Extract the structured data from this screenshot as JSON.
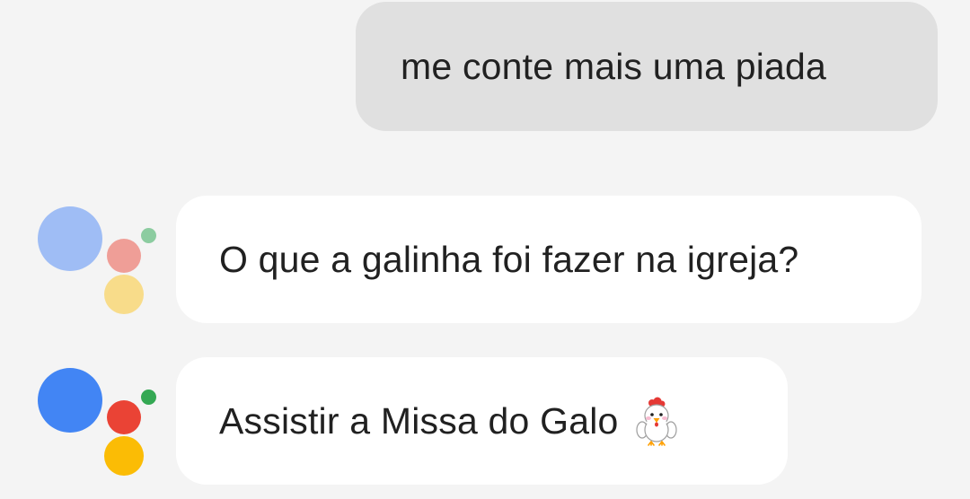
{
  "conversation": {
    "user_message": "me conte mais uma piada",
    "assistant_messages": [
      {
        "text": "O que a galinha foi fazer na igreja?",
        "avatar_state": "faded"
      },
      {
        "text": "Assistir a Missa do Galo",
        "emoji": "rooster-emoji",
        "avatar_state": "active"
      }
    ]
  },
  "icons": {
    "assistant_logo": "google-assistant-icon",
    "emoji": "rooster-emoji"
  },
  "colors": {
    "background": "#f4f4f4",
    "user_bubble": "#e0e0e0",
    "assistant_bubble": "#ffffff",
    "text": "#212121",
    "logo_active": {
      "blue": "#4285f4",
      "red": "#ea4335",
      "yellow": "#fbbc05",
      "green": "#34a853"
    },
    "logo_faded": {
      "blue": "#9fbdf5",
      "red": "#ef9e97",
      "yellow": "#f8dc8a",
      "green": "#8ccca0"
    }
  }
}
